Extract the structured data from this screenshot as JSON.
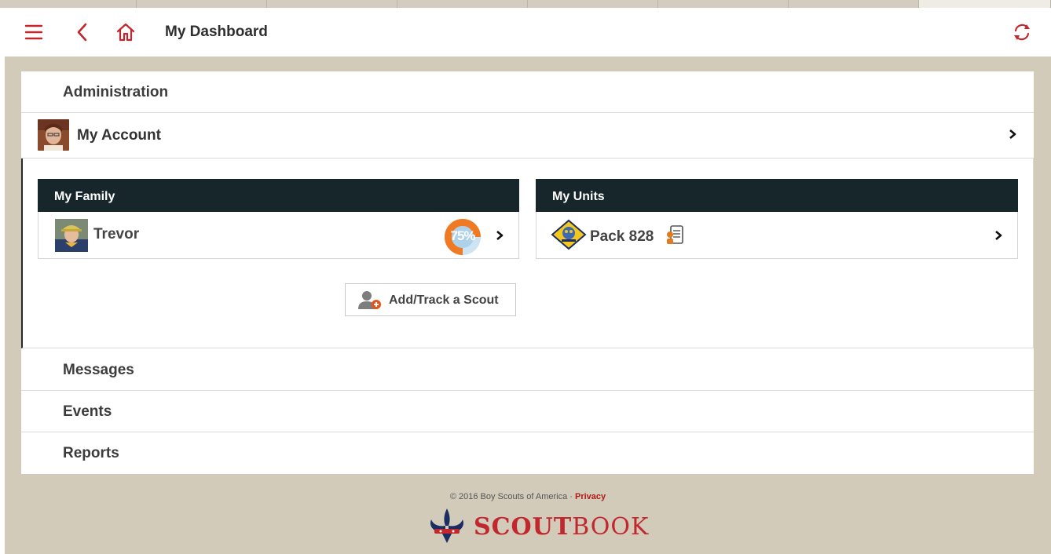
{
  "header": {
    "title": "My Dashboard"
  },
  "sections": {
    "administration": "Administration",
    "messages": "Messages",
    "events": "Events",
    "reports": "Reports"
  },
  "account": {
    "label": "My Account"
  },
  "family": {
    "heading": "My Family",
    "scouts": [
      {
        "name": "Trevor",
        "progress_label": "75%",
        "progress_fraction": 0.75
      }
    ],
    "add_button_label": "Add/Track a Scout"
  },
  "units": {
    "heading": "My Units",
    "items": [
      {
        "name": "Pack 828"
      }
    ]
  },
  "footer": {
    "copyright": "© 2016 Boy Scouts of America · ",
    "privacy_label": "Privacy",
    "brand_bold": "SCOUT",
    "brand_light": "BOOK"
  },
  "colors": {
    "accent_red": "#c1272d",
    "panel_header": "#16262b",
    "background": "#d2cbba"
  },
  "icons": [
    "hamburger-menu-icon",
    "back-chevron-icon",
    "home-icon",
    "sync-icon",
    "chevron-right-icon",
    "add-scout-icon",
    "unit-roster-icon",
    "fleur-de-lis-logo"
  ]
}
